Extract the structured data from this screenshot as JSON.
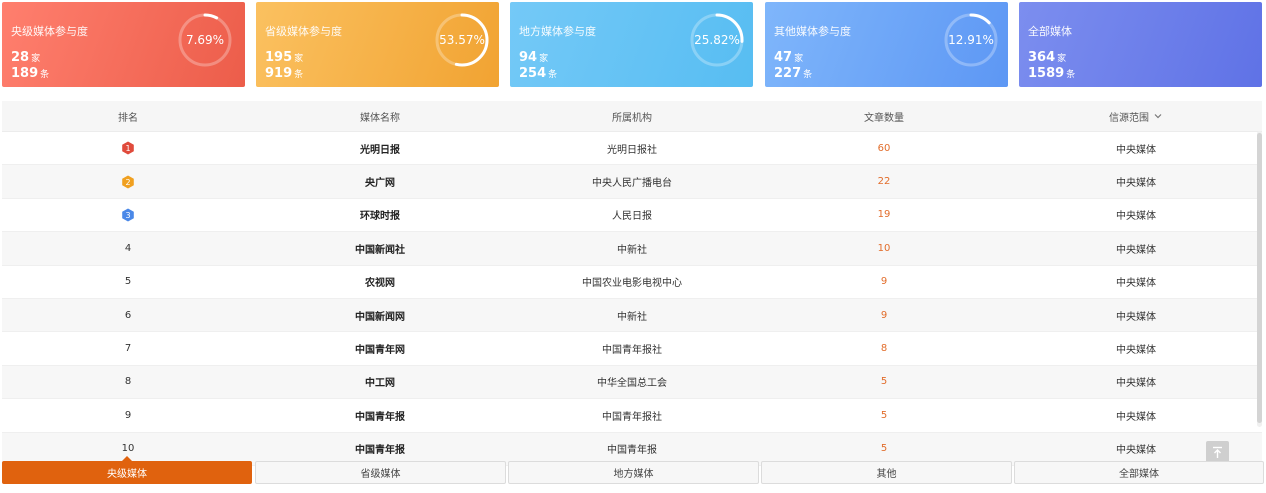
{
  "cards": [
    {
      "title": "央级媒体参与度",
      "count": "28",
      "count_unit": "家",
      "articles": "189",
      "articles_unit": "条",
      "percent_text": "7.69%",
      "percent": 0.0769
    },
    {
      "title": "省级媒体参与度",
      "count": "195",
      "count_unit": "家",
      "articles": "919",
      "articles_unit": "条",
      "percent_text": "53.57%",
      "percent": 0.5357
    },
    {
      "title": "地方媒体参与度",
      "count": "94",
      "count_unit": "家",
      "articles": "254",
      "articles_unit": "条",
      "percent_text": "25.82%",
      "percent": 0.2582
    },
    {
      "title": "其他媒体参与度",
      "count": "47",
      "count_unit": "家",
      "articles": "227",
      "articles_unit": "条",
      "percent_text": "12.91%",
      "percent": 0.1291
    },
    {
      "title": "全部媒体",
      "count": "364",
      "count_unit": "家",
      "articles": "1589",
      "articles_unit": "条"
    }
  ],
  "table": {
    "headers": {
      "rank": "排名",
      "name": "媒体名称",
      "org": "所属机构",
      "count": "文章数量",
      "scope": "信源范围"
    },
    "rows": [
      {
        "rank": "1",
        "name": "光明日报",
        "org": "光明日报社",
        "count": "60",
        "scope": "中央媒体"
      },
      {
        "rank": "2",
        "name": "央广网",
        "org": "中央人民广播电台",
        "count": "22",
        "scope": "中央媒体"
      },
      {
        "rank": "3",
        "name": "环球时报",
        "org": "人民日报",
        "count": "19",
        "scope": "中央媒体"
      },
      {
        "rank": "4",
        "name": "中国新闻社",
        "org": "中新社",
        "count": "10",
        "scope": "中央媒体"
      },
      {
        "rank": "5",
        "name": "农视网",
        "org": "中国农业电影电视中心",
        "count": "9",
        "scope": "中央媒体"
      },
      {
        "rank": "6",
        "name": "中国新闻网",
        "org": "中新社",
        "count": "9",
        "scope": "中央媒体"
      },
      {
        "rank": "7",
        "name": "中国青年网",
        "org": "中国青年报社",
        "count": "8",
        "scope": "中央媒体"
      },
      {
        "rank": "8",
        "name": "中工网",
        "org": "中华全国总工会",
        "count": "5",
        "scope": "中央媒体"
      },
      {
        "rank": "9",
        "name": "中国青年报",
        "org": "中国青年报社",
        "count": "5",
        "scope": "中央媒体"
      },
      {
        "rank": "10",
        "name": "中国青年报",
        "org": "中国青年报",
        "count": "5",
        "scope": "中央媒体"
      }
    ]
  },
  "badge_colors": [
    "#e04b3c",
    "#f0a020",
    "#4a88e8"
  ],
  "tabs": [
    "央级媒体",
    "省级媒体",
    "地方媒体",
    "其他",
    "全部媒体"
  ],
  "active_tab": 0,
  "icons": {
    "scroll_top": "arrow-to-top-icon",
    "scope_filter": "chevron-down-icon",
    "rank_badge": "hexagon-badge-icon"
  }
}
